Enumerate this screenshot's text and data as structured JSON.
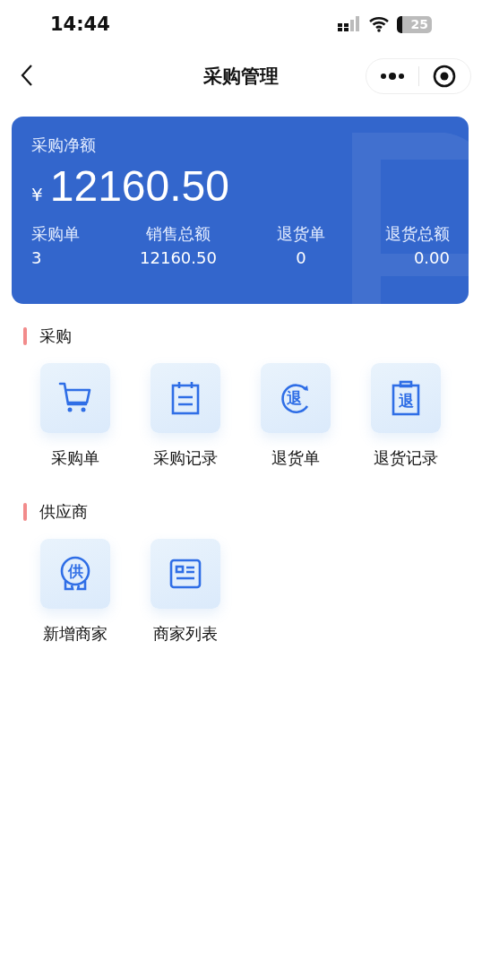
{
  "status_bar": {
    "time": "14:44",
    "battery": "25"
  },
  "nav": {
    "title": "采购管理"
  },
  "summary": {
    "label": "采购净额",
    "currency": "¥",
    "amount": "12160.50",
    "stats": [
      {
        "label": "采购单",
        "value": "3"
      },
      {
        "label": "销售总额",
        "value": "12160.50"
      },
      {
        "label": "退货单",
        "value": "0"
      },
      {
        "label": "退货总额",
        "value": "0.00"
      }
    ]
  },
  "sections": [
    {
      "title": "采购",
      "items": [
        {
          "label": "采购单",
          "kind": "cart"
        },
        {
          "label": "采购记录",
          "kind": "notepad"
        },
        {
          "label": "退货单",
          "kind": "return-circle",
          "glyph": "退"
        },
        {
          "label": "退货记录",
          "kind": "clipboard",
          "glyph": "退"
        }
      ]
    },
    {
      "title": "供应商",
      "items": [
        {
          "label": "新增商家",
          "kind": "badge",
          "glyph": "供"
        },
        {
          "label": "商家列表",
          "kind": "list-card"
        }
      ]
    }
  ]
}
